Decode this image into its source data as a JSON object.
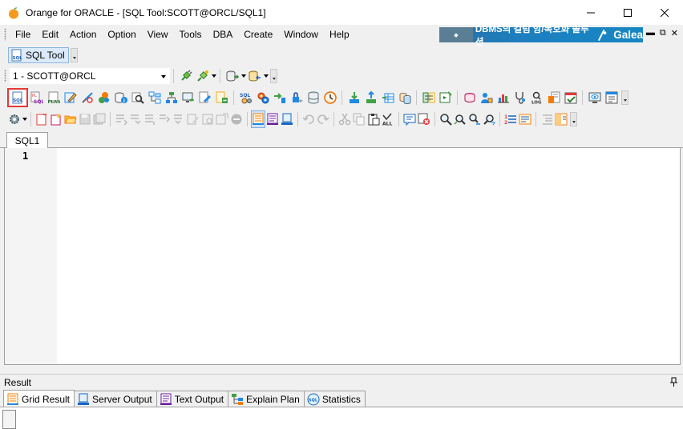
{
  "window": {
    "title": "Orange for ORACLE - [SQL Tool:SCOTT@ORCL/SQL1]",
    "minimize_label": "minimize",
    "maximize_label": "maximize",
    "close_label": "close"
  },
  "menu": {
    "items": [
      "File",
      "Edit",
      "Action",
      "Option",
      "View",
      "Tools",
      "DBA",
      "Create",
      "Window",
      "Help"
    ],
    "banner_text": "DBMS의 컬럼 암/복호화 솔루션",
    "banner_brand": "Galea"
  },
  "tool_bar": {
    "sql_tool_label": "SQL Tool"
  },
  "connection": {
    "selected": "1 - SCOTT@ORCL"
  },
  "document_tab": {
    "label": "SQL1"
  },
  "editor": {
    "line_number": "1",
    "content": ""
  },
  "result": {
    "title": "Result",
    "tabs": [
      {
        "label": "Grid Result",
        "active": true
      },
      {
        "label": "Server Output",
        "active": false
      },
      {
        "label": "Text Output",
        "active": false
      },
      {
        "label": "Explain Plan",
        "active": false
      },
      {
        "label": "Statistics",
        "active": false
      }
    ]
  },
  "colors": {
    "selection_outline": "#e53935",
    "banner": "#1d7fbf",
    "tab_active": "#ffffff"
  }
}
